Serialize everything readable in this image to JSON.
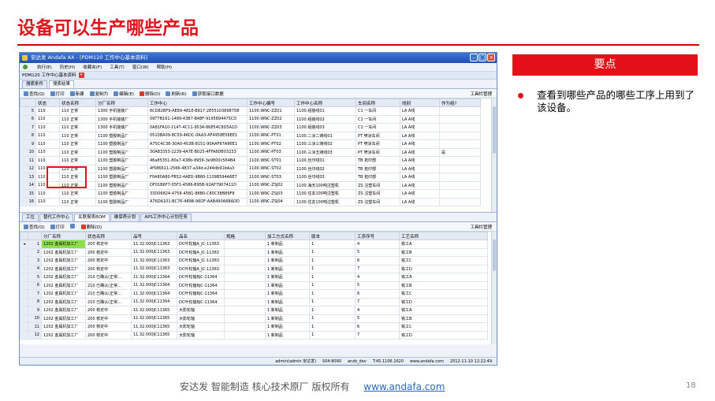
{
  "slide": {
    "title": "设备可以生产哪些产品",
    "keypoint_header": "要点",
    "keypoint_text": "查看到哪些产品的哪些工序上用到了该设备。",
    "footer_text": "安达发  智能制造 核心技术原厂  版权所有",
    "footer_link": "www.andafa.com",
    "page_number": "18"
  },
  "window": {
    "title": "安达发 Andafa AX - [PDM120 工作中心基本资料]",
    "menu": [
      "执行(E)",
      "历史(H)",
      "收藏夹(F)",
      "工具(T)",
      "窗口(W)",
      "帮助(H)"
    ],
    "doc_tab": "PDM120 工作中心基本资料",
    "tabs": [
      "搜索条件",
      "搜索结果"
    ],
    "top_toolbar": [
      "查找(Q)",
      "打印",
      "新建",
      "复制为",
      "编辑(E)",
      "删除(D)",
      "刷新(R)",
      "获取接口数据"
    ],
    "toolbar_manage": "工具栏管理",
    "top_columns": [
      "",
      "状态",
      "状态名称",
      "分厂名称",
      "工作中心",
      "工作中心编号",
      "工作中心名称",
      "车间名称",
      "线别",
      "作为组?"
    ],
    "top_rows": [
      [
        "5",
        "110",
        "110 正常",
        "1300 手机摇装厂",
        "6CD82BF9-AE89-481E-B817-2E5510389875B",
        "1100.WNC-ZZ01",
        "1100.组装线01",
        "C1 一车间",
        "LA A线",
        ""
      ],
      [
        "6",
        "110",
        "110 正常",
        "1300 手机摇装厂",
        "09T7B161-1489-43B7-B48F-9195894475CD",
        "1100.WNC-ZZ02",
        "1100.组装线02",
        "C1 一车间",
        "LA A线",
        ""
      ],
      [
        "7",
        "110",
        "110 正常",
        "1300 手机摇装厂",
        "0A81FA10-1147-4C11-953A-86854C8D5A1D",
        "1100.WNC-ZZ03",
        "1100.组装线03",
        "C1 一车间",
        "LA A线",
        ""
      ],
      [
        "8",
        "110",
        "110 正常",
        "1100 塑胶制品厂",
        "0510BA09-8C59-46DC-0AA3-AF4958E56EE1",
        "1100.WNC-PT01",
        "1100.二涂二烤线01",
        "PT 喷涂车间",
        "LA A线",
        ""
      ],
      [
        "9",
        "110",
        "110 正常",
        "1100 塑胶制品厂",
        "A75C4C38-30A0-453B-8151-90AAF87A86E1",
        "1100.WNC-PT02",
        "1100.三涂三烤线02",
        "PT 喷涂车间",
        "LA A线",
        ""
      ],
      [
        "10",
        "110",
        "110 正常",
        "1100 塑胶制品厂",
        "30A83353-2239-4A7E-B025-4FFA8DB03233",
        "1100.WNC-PT03",
        "1100.三涂五烤线03",
        "PT 喷涂车间",
        "LA A线",
        "是"
      ],
      [
        "11",
        "110",
        "110 正常",
        "1100 塑胶制品厂",
        "46a85351-80a7-438b-8956-3e9800c564B4",
        "1100.WNC-ST01",
        "1100.丝印线01",
        "TB 拓印部",
        "LA A线",
        ""
      ],
      [
        "12",
        "110",
        "110 正常",
        "1100 塑胶制品厂",
        "4f586611-2566-4837-a34d-e244db91b4a3",
        "1100.WNC-ST02",
        "1100.丝印线02",
        "TB 拓印部",
        "LA A线",
        ""
      ],
      [
        "13",
        "110",
        "110 正常",
        "1100 塑胶制品厂",
        "F0A80A80-FB52-4AED-9B80-1109B594A6E7",
        "1100.WNC-ST03",
        "1100.丝印线03",
        "TB 拓印部",
        "LA A线",
        ""
      ],
      [
        "14",
        "110",
        "110 正常",
        "1100 塑胶制品厂",
        "DF01B6F7-05F1-4586-B95B-92AF7907411D",
        "1100.WNC-ZSJ02",
        "1100.海天100吨注塑机",
        "ZS 注塑车间",
        "LA A线",
        ""
      ],
      [
        "15",
        "110",
        "110 正常",
        "1100 塑胶制品厂",
        "33D06824-4756-45B1-88B0-C80C38B89F8",
        "1100.WNC-ZSJ03",
        "1100.住友100吨注塑机",
        "ZS 注塑车间",
        "LA A线",
        ""
      ],
      [
        "16",
        "110",
        "110 正常",
        "1100 塑胶制品厂",
        "A76DA101-BC76-489B-96DF-AAB490A6BADD",
        "1100.WNC-ZSJ04",
        "1100.住友100吨注塑机",
        "ZS 注塑车间",
        "LA A线",
        ""
      ]
    ],
    "bottom_tabs": [
      "工位",
      "替代工作中心",
      "关联报表BOM",
      "维保养计划",
      "APS工作中心计划任务"
    ],
    "bottom_toolbar": [
      "查找(Q)",
      "打印",
      "",
      "删除(D)"
    ],
    "bottom_columns": [
      "",
      "",
      "分厂名称",
      "状态名称",
      "品号",
      "品名",
      "规格",
      "加工方式名称",
      "版本",
      "工序序号",
      "工艺名称"
    ],
    "bottom_rows": [
      [
        "▸",
        "1",
        "1202 金属机加工厂",
        "200 核定中",
        "11.32.000JC11363",
        "DC叶轮轴A_JC-11363",
        "",
        "1 新制品",
        "1",
        "4",
        "铣工A"
      ],
      [
        "",
        "2",
        "1202 金属机加工厂",
        "200 核定中",
        "11.32.000JC11363",
        "DC叶轮轴A_JC-11363",
        "",
        "1 新制品",
        "1",
        "5",
        "铣工B"
      ],
      [
        "",
        "3",
        "1202 金属机加工厂",
        "200 核定中",
        "11.32.000JC11363",
        "DC叶轮轴A_JC-11363",
        "",
        "1 新制品",
        "1",
        "6",
        "铣工C"
      ],
      [
        "",
        "4",
        "1202 金属机加工厂",
        "200 核定中",
        "11.32.000JC11363",
        "DC叶轮轴A_JC-11363",
        "",
        "1 新制品",
        "1",
        "7",
        "铣工D"
      ],
      [
        "",
        "5",
        "1202 金属机加工厂",
        "210 已确认(正常…",
        "11.32.000JC11364",
        "DC叶轮轴BJC-11364",
        "",
        "1 新制品",
        "1",
        "4",
        "铣工A"
      ],
      [
        "",
        "6",
        "1202 金属机加工厂",
        "210 已确认(正常…",
        "11.32.000JC11364",
        "DC叶轮轴BJC-11364",
        "",
        "1 新制品",
        "1",
        "5",
        "铣工B"
      ],
      [
        "",
        "7",
        "1202 金属机加工厂",
        "210 已确认(正常…",
        "11.32.000JC11364",
        "DC叶轮轴BJC-11364",
        "",
        "1 新制品",
        "1",
        "6",
        "铣工C"
      ],
      [
        "",
        "8",
        "1202 金属机加工厂",
        "210 已确认(正常…",
        "11.32.000JC11364",
        "DC叶轮轴BJC-11364",
        "",
        "1 新制品",
        "1",
        "7",
        "铣工D"
      ],
      [
        "",
        "9",
        "1202 金属机加工厂",
        "200 核定中",
        "11.32.000JC11365",
        "大影轮轴",
        "",
        "1 新制品",
        "1",
        "4",
        "铣工A"
      ],
      [
        "",
        "10",
        "1202 金属机加工厂",
        "200 核定中",
        "11.32.000JC11365",
        "大影轮轴",
        "",
        "1 新制品",
        "1",
        "5",
        "铣工B"
      ],
      [
        "",
        "11",
        "1202 金属机加工厂",
        "200 核定中",
        "11.32.000JC11365",
        "大影轮轴",
        "",
        "1 新制品",
        "1",
        "6",
        "铣工C"
      ],
      [
        "",
        "12",
        "1202 金属机加工厂",
        "200 核定中",
        "11.32.000JC11365",
        "大影轮轴",
        "",
        "1 新制品",
        "1",
        "7",
        "铣工D"
      ]
    ],
    "status_items": [
      "admin(admin 安达发)",
      "S04:8090",
      "anzb_dev",
      "T:45.1106.1620",
      "www.andafa.com",
      "2012-11-10 12:22:49"
    ]
  }
}
